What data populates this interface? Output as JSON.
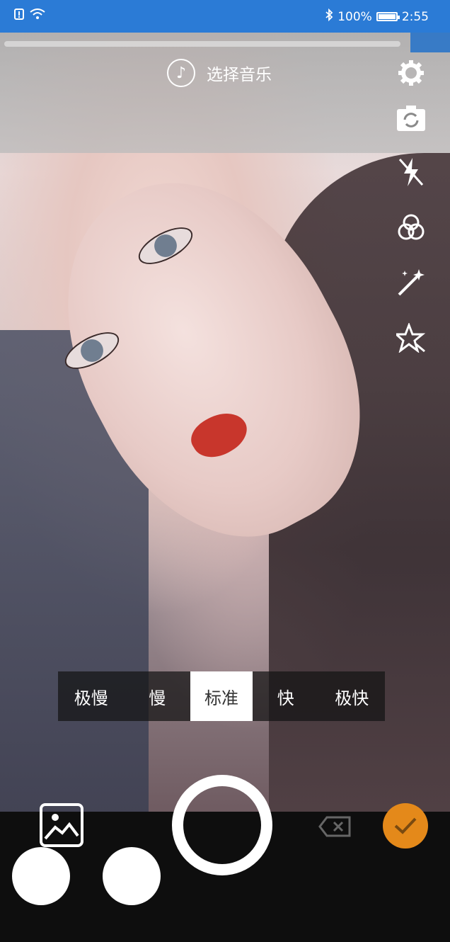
{
  "status_bar": {
    "battery_percent": "100%",
    "time": "2:55",
    "icons": [
      "sim-alert-icon",
      "wifi-icon",
      "bluetooth-icon",
      "battery-icon"
    ]
  },
  "camera": {
    "music_label": "选择音乐",
    "side_tools": [
      "settings-icon",
      "switch-camera-icon",
      "flash-off-icon",
      "filter-icon",
      "beauty-wand-icon",
      "sticker-star-icon"
    ]
  },
  "speed": {
    "options": [
      "极慢",
      "慢",
      "标准",
      "快",
      "极快"
    ],
    "selected": "标准"
  },
  "bottom": {
    "icons": [
      "gallery-icon",
      "shutter-button",
      "delete-icon",
      "confirm-check-icon"
    ],
    "accent_color": "#e4891a"
  }
}
